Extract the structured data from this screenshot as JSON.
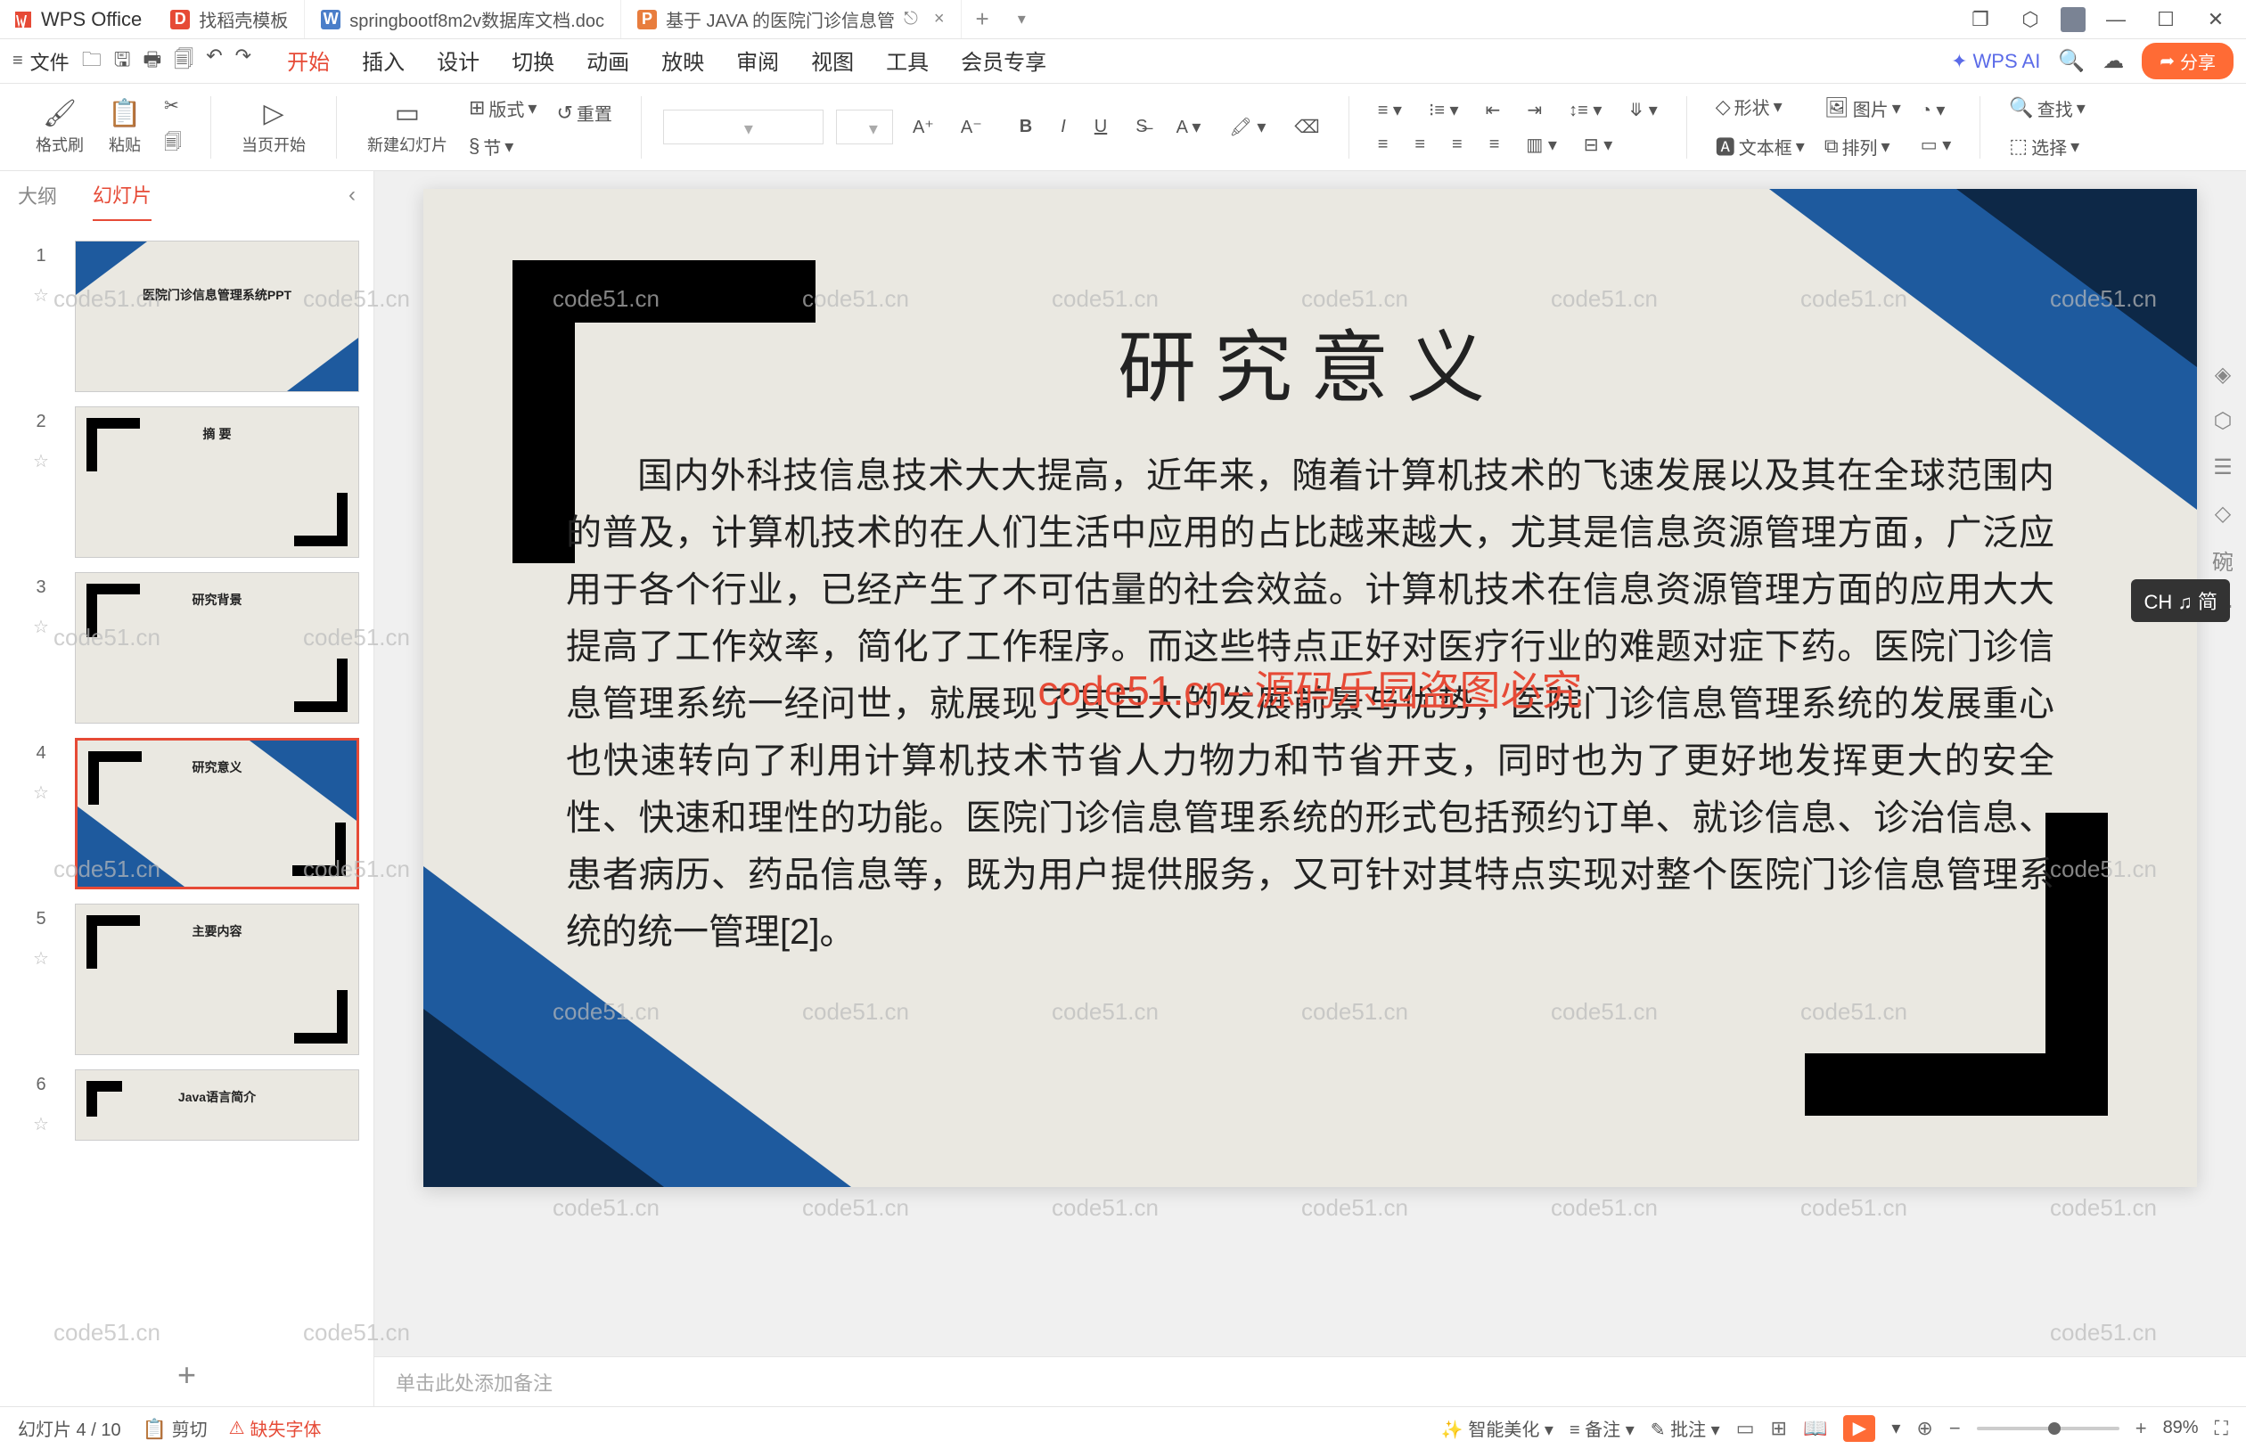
{
  "app": {
    "name": "WPS Office"
  },
  "tabs": [
    {
      "icon": "w",
      "label": "找稻壳模板"
    },
    {
      "icon": "d",
      "label": "springbootf8m2v数据库文档.doc"
    },
    {
      "icon": "p",
      "label": "基于 JAVA 的医院门诊信息管",
      "active": true
    }
  ],
  "menubar": {
    "file": "文件",
    "tabs": [
      "开始",
      "插入",
      "设计",
      "切换",
      "动画",
      "放映",
      "审阅",
      "视图",
      "工具",
      "会员专享"
    ],
    "active": "开始",
    "wps_ai": "WPS AI",
    "share": "分享"
  },
  "ribbon": {
    "format_paint": "格式刷",
    "paste": "粘贴",
    "from_current": "当页开始",
    "new_slide": "新建幻灯片",
    "layout": "版式",
    "section": "节",
    "reset": "重置",
    "shape": "形状",
    "picture": "图片",
    "textbox": "文本框",
    "arrange": "排列",
    "find": "查找",
    "select": "选择"
  },
  "sidebar": {
    "tabs": [
      "大纲",
      "幻灯片"
    ],
    "active": "幻灯片",
    "thumbs": [
      {
        "n": 1,
        "title": "医院门诊信息管理系统PPT"
      },
      {
        "n": 2,
        "title": "摘  要"
      },
      {
        "n": 3,
        "title": "研究背景"
      },
      {
        "n": 4,
        "title": "研究意义",
        "selected": true
      },
      {
        "n": 5,
        "title": "主要内容"
      },
      {
        "n": 6,
        "title": "Java语言简介"
      }
    ]
  },
  "slide": {
    "title": "研究意义",
    "body": "国内外科技信息技术大大提高，近年来，随着计算机技术的飞速发展以及其在全球范围内的普及，计算机技术的在人们生活中应用的占比越来越大，尤其是信息资源管理方面，广泛应用于各个行业，已经产生了不可估量的社会效益。计算机技术在信息资源管理方面的应用大大提高了工作效率，简化了工作程序。而这些特点正好对医疗行业的难题对症下药。医院门诊信息管理系统一经问世，就展现了其巨大的发展前景与优势，医院门诊信息管理系统的发展重心也快速转向了利用计算机技术节省人力物力和节省开支，同时也为了更好地发挥更大的安全性、快速和理性的功能。医院门诊信息管理系统的形式包括预约订单、就诊信息、诊治信息、患者病历、药品信息等，既为用户提供服务，又可针对其特点实现对整个医院门诊信息管理系统的统一管理[2]。",
    "watermark_center": "code51.cn--源码乐园盗图必究"
  },
  "notes": {
    "placeholder": "单击此处添加备注"
  },
  "statusbar": {
    "slide_counter": "幻灯片 4 / 10",
    "clip": "剪切",
    "missing_font": "缺失字体",
    "smart_beautify": "智能美化",
    "notes": "备注",
    "review": "批注",
    "zoom": "89%"
  },
  "ime": {
    "badge": "CH ♫ 简"
  },
  "watermark": "code51.cn"
}
